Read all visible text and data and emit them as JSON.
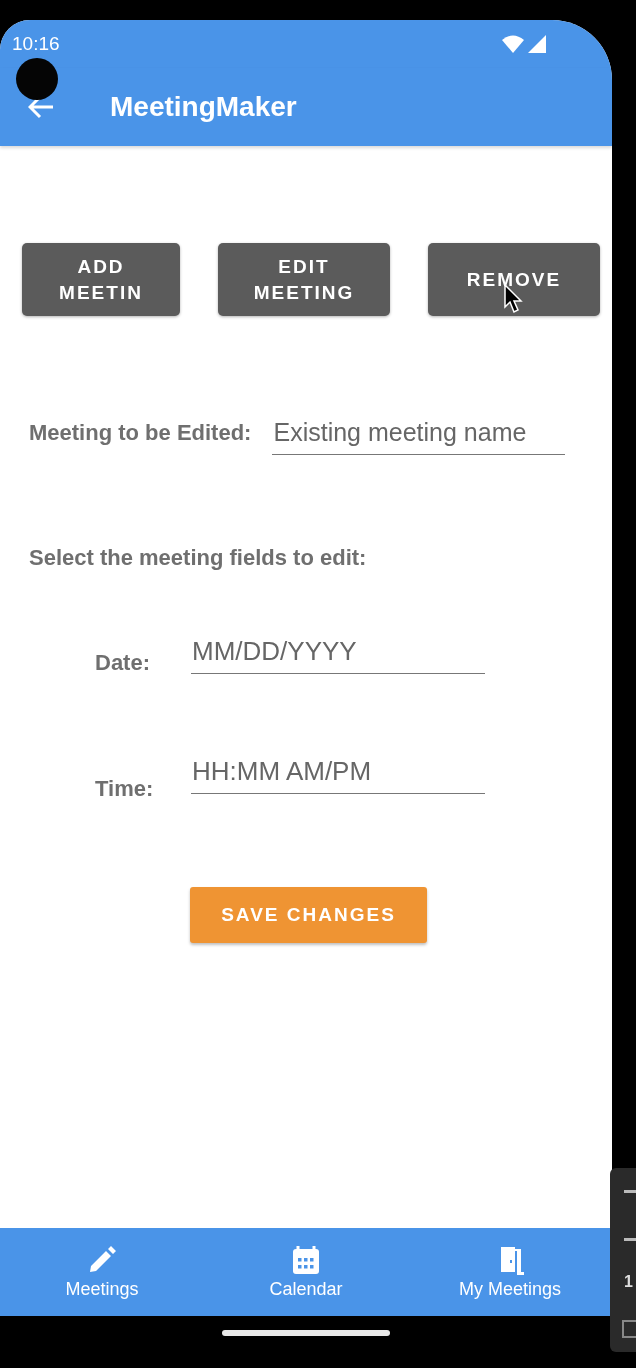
{
  "status_bar": {
    "time": "10:16"
  },
  "app_bar": {
    "title": "MeetingMaker"
  },
  "action_buttons": [
    {
      "label": "ADD MEETIN"
    },
    {
      "label": "EDIT MEETING"
    },
    {
      "label": "REMOVE"
    }
  ],
  "meeting_field": {
    "label": "Meeting to be Edited:",
    "placeholder": "Existing meeting name"
  },
  "section_heading": "Select the meeting fields to edit:",
  "fields": [
    {
      "label": "Date:",
      "placeholder": "MM/DD/YYYY"
    },
    {
      "label": "Time:",
      "placeholder": "HH:MM AM/PM"
    }
  ],
  "save_button": {
    "label": "SAVE CHANGES"
  },
  "bottom_nav": [
    {
      "kind": "pencil",
      "label": "Meetings"
    },
    {
      "kind": "calendar",
      "label": "Calendar"
    },
    {
      "kind": "door",
      "label": "My Meetings"
    }
  ],
  "emulator_panel": {
    "zoom_label": "1"
  }
}
